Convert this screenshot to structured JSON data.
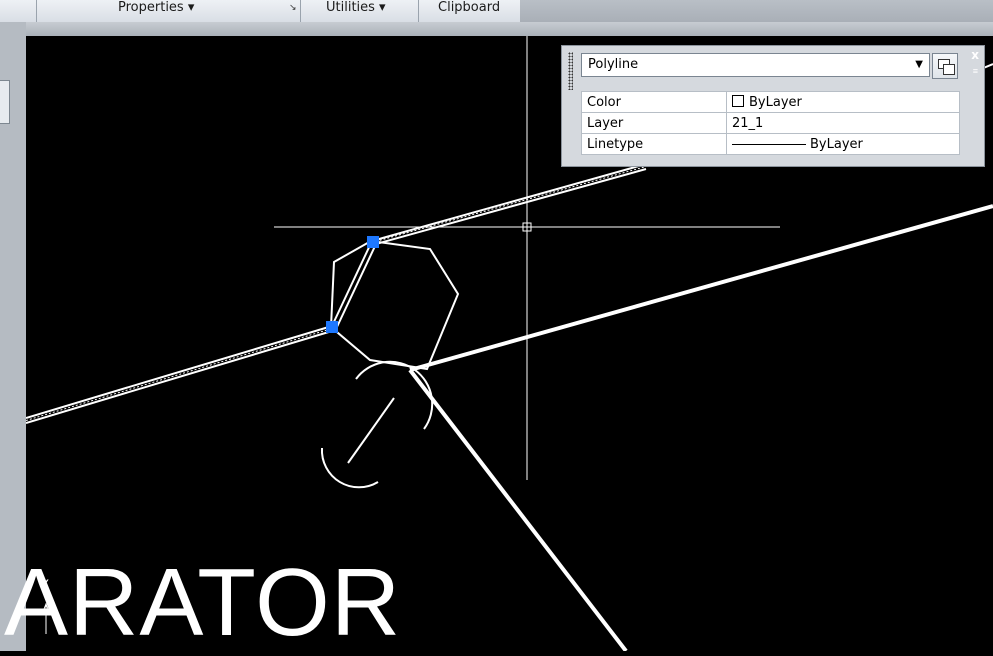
{
  "ribbon": {
    "panels": [
      {
        "label": "Properties ▾"
      },
      {
        "label": "Utilities ▾"
      },
      {
        "label": "Clipboard"
      }
    ],
    "launcher_icon": "dialog-launcher-icon"
  },
  "quick_properties": {
    "object_type": "Polyline",
    "rows": [
      {
        "property": "Color",
        "value": "ByLayer"
      },
      {
        "property": "Layer",
        "value": "21_1"
      },
      {
        "property": "Linetype",
        "value": "ByLayer"
      }
    ],
    "icons": [
      "grip-icon",
      "dropdown-arrow-icon",
      "quick-select-icon",
      "close-icon",
      "panel-menu-icon"
    ]
  },
  "canvas": {
    "text_visible": "ARATOR",
    "ucs_label": "Y",
    "background": "#000000",
    "grip_color": "#1e78ff",
    "geometry_color": "#ffffff"
  }
}
